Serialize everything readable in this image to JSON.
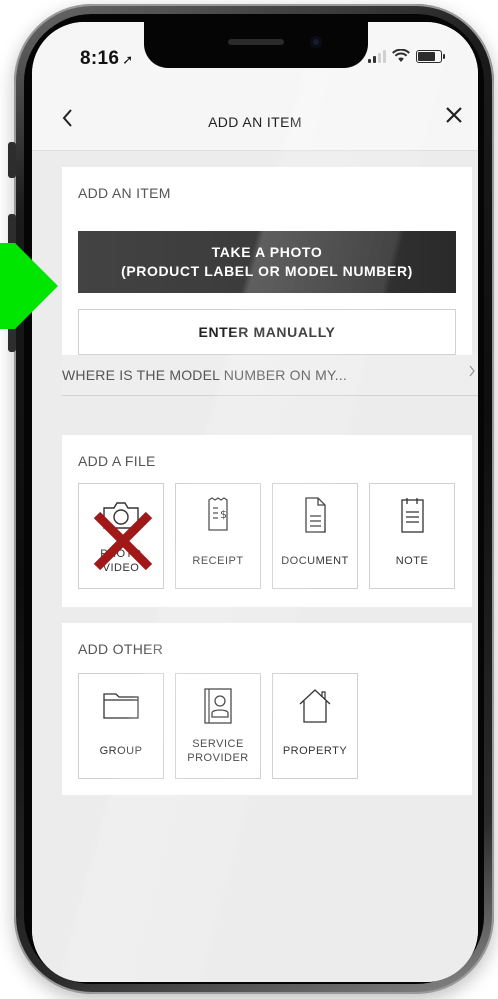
{
  "status": {
    "time": "8:16",
    "location_icon": "location-arrow-icon"
  },
  "nav": {
    "title": "ADD AN ITEM",
    "back_icon": "chevron-left-icon",
    "close_icon": "close-icon"
  },
  "add_item": {
    "title": "ADD AN ITEM",
    "photo_line1": "TAKE A PHOTO",
    "photo_line2": "(PRODUCT LABEL OR MODEL NUMBER)",
    "manual_label": "ENTER MANUALLY"
  },
  "model_link": {
    "label": "WHERE IS THE MODEL NUMBER ON MY...",
    "chevron_icon": "chevron-right-icon"
  },
  "add_file": {
    "title": "ADD A FILE",
    "tiles": [
      {
        "line1": "PHOTO",
        "line2": "VIDEO",
        "icon": "camera-icon",
        "crossed_out": true
      },
      {
        "label": "RECEIPT",
        "icon": "receipt-icon"
      },
      {
        "label": "DOCUMENT",
        "icon": "document-icon"
      },
      {
        "label": "NOTE",
        "icon": "note-icon"
      }
    ]
  },
  "add_other": {
    "title": "ADD OTHER",
    "tiles": [
      {
        "label": "GROUP",
        "icon": "folder-icon"
      },
      {
        "line1": "SERVICE",
        "line2": "PROVIDER",
        "icon": "contact-card-icon"
      },
      {
        "label": "PROPERTY",
        "icon": "house-icon"
      }
    ]
  },
  "colors": {
    "accent_dark": "#3a3a3a",
    "annotation_green": "#00e600",
    "annotation_red": "#a01818"
  }
}
